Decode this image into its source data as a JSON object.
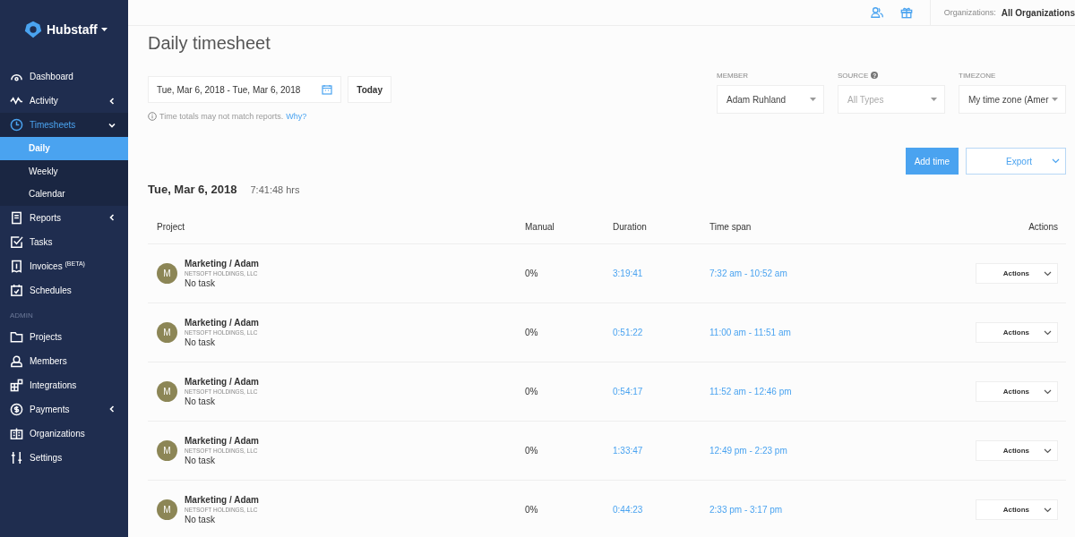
{
  "brand": "Hubstaff",
  "sidebar": {
    "items": [
      {
        "label": "Dashboard",
        "selected": false,
        "expandable": false
      },
      {
        "label": "Activity",
        "selected": false,
        "expandable": true,
        "expanded": false
      },
      {
        "label": "Timesheets",
        "selected": true,
        "expandable": true,
        "expanded": true,
        "children": [
          {
            "label": "Daily",
            "selected": true
          },
          {
            "label": "Weekly",
            "selected": false
          },
          {
            "label": "Calendar",
            "selected": false
          }
        ]
      },
      {
        "label": "Reports",
        "selected": false,
        "expandable": true,
        "expanded": false
      },
      {
        "label": "Tasks",
        "selected": false,
        "expandable": false
      },
      {
        "label": "Invoices $^{(BETA)}$",
        "selected": false,
        "expandable": false
      },
      {
        "label": "Schedules",
        "selected": false,
        "expandable": false
      }
    ],
    "section": "ADMIN",
    "admin_items": [
      {
        "label": "Projects",
        "selected": false,
        "expandable": false
      },
      {
        "label": "Members",
        "selected": false,
        "expandable": false
      },
      {
        "label": "Integrations",
        "selected": false,
        "expandable": false
      },
      {
        "label": "Payments",
        "selected": false,
        "expandable": true,
        "expanded": false
      },
      {
        "label": "Organizations",
        "selected": false,
        "expandable": false
      },
      {
        "label": "Settings",
        "selected": false,
        "expandable": false
      }
    ]
  },
  "topbar": {
    "org_label": "Organizations:",
    "org_value": "All Organizations"
  },
  "title": "Daily timesheet",
  "date_range": "Tue, Mar 6, 2018 - Tue, Mar 6, 2018",
  "today_button": "Today",
  "note": "Time totals may not match reports.",
  "note_link": "Why?",
  "filters": [
    {
      "label": "MEMBER",
      "value": "Adam Ruhland",
      "placeholder_style": false
    },
    {
      "label": "SOURCE",
      "help_mark": "?",
      "value": "All Types",
      "placeholder_style": true
    },
    {
      "label": "TIMEZONE",
      "value": "My time zone (Amer",
      "placeholder_style": false
    }
  ],
  "add_button": "Add time",
  "export_button": "Export",
  "day": {
    "date": "Tue, Mar 6, 2018",
    "total": "7:41:48 hrs"
  },
  "table": {
    "columns": [
      "Project",
      "Manual",
      "Duration",
      "Time span",
      "Actions"
    ],
    "rows": [
      {
        "avatar": "M",
        "project": "Marketing / Adam",
        "org": "NETSOFT HOLDINGS, LLC",
        "task": "No task",
        "manual": "0%",
        "duration": "3:19:41",
        "span": "7:32 am - 10:52 am",
        "action": "Actions"
      },
      {
        "avatar": "M",
        "project": "Marketing / Adam",
        "org": "NETSOFT HOLDINGS, LLC",
        "task": "No task",
        "manual": "0%",
        "duration": "0:51:22",
        "span": "11:00 am - 11:51 am",
        "action": "Actions"
      },
      {
        "avatar": "M",
        "project": "Marketing / Adam",
        "org": "NETSOFT HOLDINGS, LLC",
        "task": "No task",
        "manual": "0%",
        "duration": "0:54:17",
        "span": "11:52 am - 12:46 pm",
        "action": "Actions"
      },
      {
        "avatar": "M",
        "project": "Marketing / Adam",
        "org": "NETSOFT HOLDINGS, LLC",
        "task": "No task",
        "manual": "0%",
        "duration": "1:33:47",
        "span": "12:49 pm - 2:23 pm",
        "action": "Actions"
      },
      {
        "avatar": "M",
        "project": "Marketing / Adam",
        "org": "NETSOFT HOLDINGS, LLC",
        "task": "No task",
        "manual": "0%",
        "duration": "0:44:23",
        "span": "2:33 pm - 3:17 pm",
        "action": "Actions"
      }
    ]
  }
}
